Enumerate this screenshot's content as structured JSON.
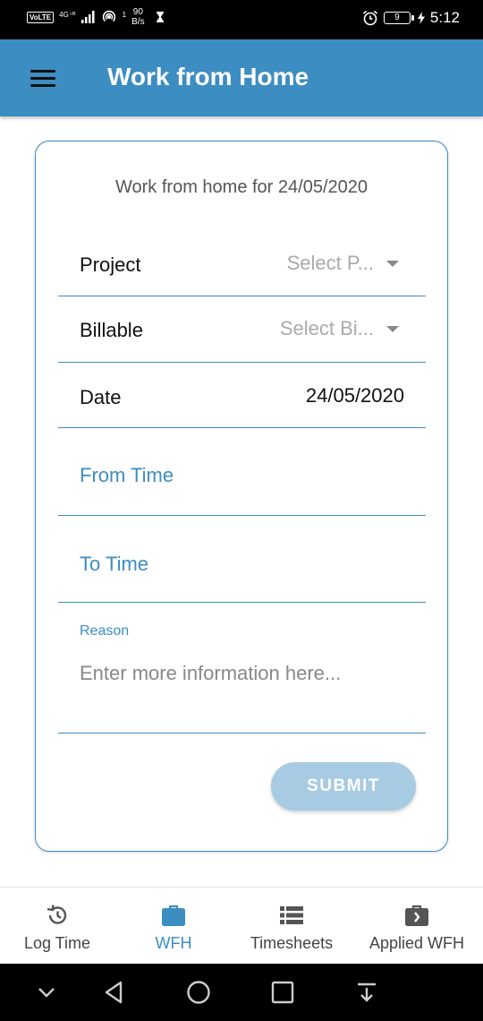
{
  "status_bar": {
    "volte": "VoLTE",
    "network_type": "4G⁺ᴿ",
    "data_arrow": "1",
    "net_speed_value": "90",
    "net_speed_unit": "B/s",
    "battery": "9",
    "time": "5:12"
  },
  "app_bar": {
    "title": "Work from Home",
    "color": "#3c8dc1"
  },
  "form": {
    "heading": "Work from home for 24/05/2020",
    "project": {
      "label": "Project",
      "placeholder": "Select P..."
    },
    "billable": {
      "label": "Billable",
      "placeholder": "Select Bi..."
    },
    "date": {
      "label": "Date",
      "value": "24/05/2020"
    },
    "from_time": {
      "label": "From Time"
    },
    "to_time": {
      "label": "To Time"
    },
    "reason": {
      "label": "Reason",
      "placeholder": "Enter more information here..."
    },
    "submit_label": "SUBMIT"
  },
  "bottom_nav": {
    "items": [
      {
        "label": "Log Time",
        "icon": "clock-history-icon",
        "active": false
      },
      {
        "label": "WFH",
        "icon": "briefcase-icon",
        "active": true
      },
      {
        "label": "Timesheets",
        "icon": "list-icon",
        "active": false
      },
      {
        "label": "Applied WFH",
        "icon": "briefcase-arrow-icon",
        "active": false
      }
    ]
  },
  "system_nav": {
    "icons": [
      "chevron-down-icon",
      "back-icon",
      "home-icon",
      "recents-icon",
      "notification-pull-icon"
    ]
  }
}
